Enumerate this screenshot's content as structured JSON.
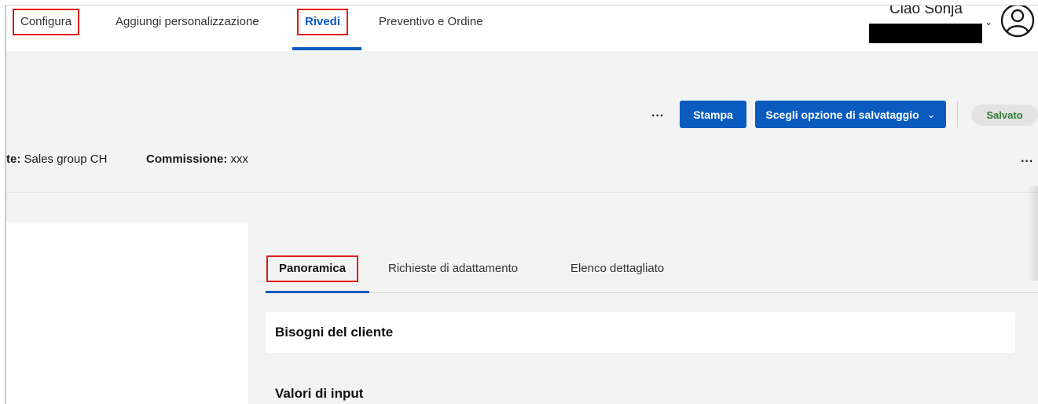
{
  "nav": {
    "items": [
      {
        "label": "Configura"
      },
      {
        "label": "Aggiungi personalizzazione"
      },
      {
        "label": "Rivedi"
      },
      {
        "label": "Preventivo e Ordine"
      }
    ]
  },
  "user": {
    "greeting": "Ciao Sonja",
    "chevron": "⌄",
    "icon": "user-circle-icon"
  },
  "toolbar": {
    "more": "...",
    "print_label": "Stampa",
    "save_option_label": "Scegli opzione di salvataggio",
    "save_option_chevron": "⌄",
    "status": "Salvato"
  },
  "info": {
    "client_label": "te:",
    "client_value": "Sales group CH",
    "commission_label": "Commissione:",
    "commission_value": "xxx",
    "more": "..."
  },
  "tabs": [
    {
      "label": "Panoramica"
    },
    {
      "label": "Richieste di adattamento"
    },
    {
      "label": "Elenco dettagliato"
    }
  ],
  "content": {
    "card_title": "Bisogni del cliente",
    "section_title": "Valori di input"
  },
  "colors": {
    "accent": "#0b5bbf",
    "highlight_box": "#e21b1b",
    "saved_text": "#2e7d32",
    "page_bg": "#f3f3f3"
  }
}
